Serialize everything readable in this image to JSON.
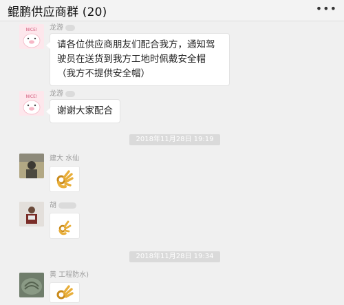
{
  "header": {
    "title": "鲲鹏供应商群 (20)",
    "more_icon": "ellipsis-icon"
  },
  "messages": [
    {
      "sender": "龙游",
      "text": "请各位供应商朋友们配合我方，通知驾驶员在送货到我方工地时佩戴安全帽（我方不提供安全帽）",
      "avatar_label": "NICE!"
    },
    {
      "sender": "龙游",
      "text": "谢谢大家配合",
      "avatar_label": "NICE!"
    }
  ],
  "timestamps": [
    "2018年11月28日 19:19",
    "2018年11月28日 19:34"
  ],
  "emoji_messages": [
    {
      "sender": "建大  水仙",
      "emoji": "ok-hand-emoji"
    },
    {
      "sender": "胡",
      "emoji": "ok-hand-emoji"
    },
    {
      "sender": "黄  工程防水)",
      "emoji": "ok-hand-emoji"
    }
  ],
  "colors": {
    "background": "#f0f0f0",
    "bubble": "#ffffff",
    "timestamp_bg": "#dadada"
  }
}
